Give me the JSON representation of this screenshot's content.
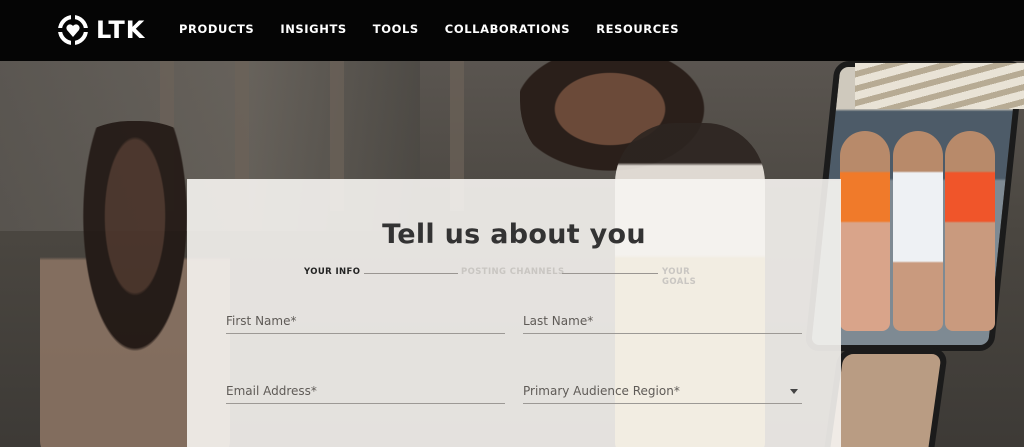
{
  "brand": {
    "name": "LTK"
  },
  "nav": {
    "items": [
      {
        "label": "PRODUCTS"
      },
      {
        "label": "INSIGHTS"
      },
      {
        "label": "TOOLS"
      },
      {
        "label": "COLLABORATIONS"
      },
      {
        "label": "RESOURCES"
      }
    ]
  },
  "form": {
    "title": "Tell us about you",
    "steps": [
      {
        "label": "YOUR INFO",
        "state": "active"
      },
      {
        "label": "POSTING CHANNELS",
        "state": "inactive"
      },
      {
        "label": "YOUR GOALS",
        "state": "inactive"
      }
    ],
    "first_name": {
      "placeholder": "First Name*",
      "value": ""
    },
    "last_name": {
      "placeholder": "Last Name*",
      "value": ""
    },
    "email": {
      "placeholder": "Email Address*",
      "value": ""
    },
    "region": {
      "placeholder": "Primary Audience Region*",
      "value": ""
    }
  },
  "colors": {
    "header_bg": "#050505",
    "panel_bg": "#f6f4f1",
    "text_dark": "#333333"
  }
}
